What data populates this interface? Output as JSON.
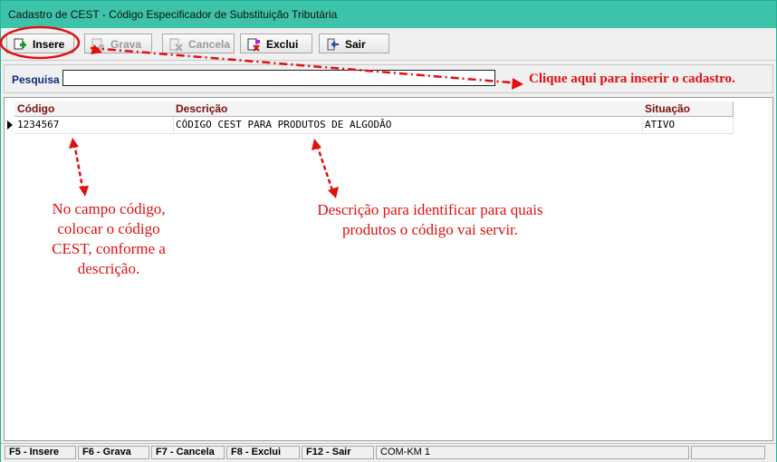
{
  "window": {
    "title": "Cadastro de CEST - Código Especificador de Substituição Tributária"
  },
  "toolbar": {
    "insere": "Insere",
    "grava": "Grava",
    "cancela": "Cancela",
    "exclui": "Exclui",
    "sair": "Sair"
  },
  "search": {
    "label": "Pesquisa",
    "value": ""
  },
  "grid": {
    "columns": [
      "Código",
      "Descrição",
      "Situação"
    ],
    "rows": [
      {
        "codigo": "1234567",
        "descricao": "CÓDIGO CEST PARA PRODUTOS DE ALGODÃO",
        "situacao": "ATIVO"
      }
    ]
  },
  "annotations": {
    "insert": "Clique aqui para inserir o cadastro.",
    "codigo": [
      "No campo código,",
      "colocar o código",
      "CEST, conforme a",
      "descrição."
    ],
    "descricao": [
      "Descrição para identificar para quais",
      "produtos o código vai servir."
    ]
  },
  "statusbar": {
    "f5": "F5 - Insere",
    "f6": "F6 - Grava",
    "f7": "F7 - Cancela",
    "f8": "F8 - Exclui",
    "f12": "F12 - Sair",
    "info": "COM-KM 1"
  },
  "colors": {
    "titlebar": "#3cc3a9",
    "annotation": "#e01010",
    "header_text": "#7a1010"
  }
}
